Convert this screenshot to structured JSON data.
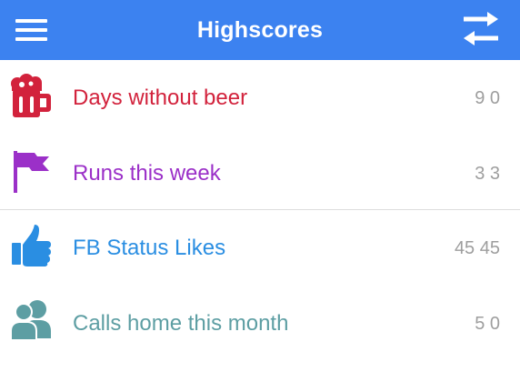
{
  "header": {
    "title": "Highscores",
    "menu_icon": "hamburger-menu-icon",
    "swap_icon": "swap-arrows-icon",
    "background_color": "#3c82f0"
  },
  "scores": [
    {
      "icon": "beer-mug-icon",
      "label": "Days without beer",
      "value": "9 0",
      "color": "#d2223c"
    },
    {
      "icon": "flag-icon",
      "label": "Runs this week",
      "value": "3 3",
      "color": "#9b30c8"
    },
    {
      "icon": "thumbs-up-icon",
      "label": "FB Status Likes",
      "value": "45 45",
      "color": "#2a8ee2"
    },
    {
      "icon": "people-icon",
      "label": "Calls home this month",
      "value": "5 0",
      "color": "#5d9ea3"
    }
  ]
}
